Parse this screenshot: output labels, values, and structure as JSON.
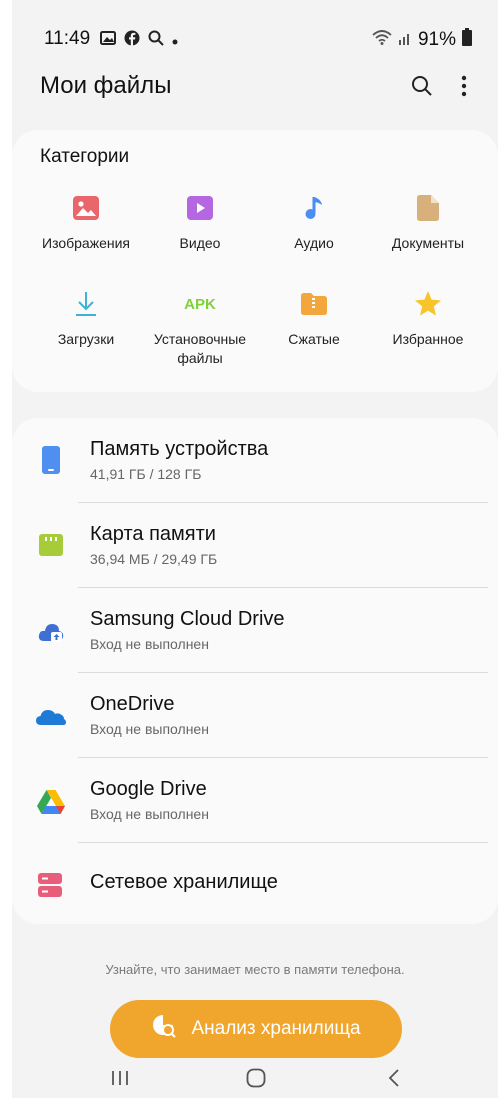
{
  "status_bar": {
    "time": "11:49",
    "battery": "91%"
  },
  "header": {
    "title": "Мои файлы"
  },
  "categories": {
    "title": "Категории",
    "items": [
      {
        "label": "Изображения",
        "icon": "image-icon",
        "color": "#e9676b"
      },
      {
        "label": "Видео",
        "icon": "video-icon",
        "color": "#b467e0"
      },
      {
        "label": "Аудио",
        "icon": "music-note-icon",
        "color": "#4a8ff0"
      },
      {
        "label": "Документы",
        "icon": "document-icon",
        "color": "#d7b07c"
      },
      {
        "label": "Загрузки",
        "icon": "download-icon",
        "color": "#3fb1d5"
      },
      {
        "label": "Установочные файлы",
        "icon_text": "APK",
        "icon": "apk-icon",
        "color": "#7fd13b"
      },
      {
        "label": "Сжатые",
        "icon": "archive-icon",
        "color": "#f3a63b"
      },
      {
        "label": "Избранное",
        "icon": "star-icon",
        "color": "#f7c52b"
      }
    ]
  },
  "storage": [
    {
      "name": "Память устройства",
      "sub": "41,91 ГБ / 128 ГБ",
      "icon": "phone-storage-icon",
      "color": "#4e8ff0"
    },
    {
      "name": "Карта памяти",
      "sub": "36,94 МБ / 29,49 ГБ",
      "icon": "sd-card-icon",
      "color": "#a6cc3a"
    },
    {
      "name": "Samsung Cloud Drive",
      "sub": "Вход не выполнен",
      "icon": "samsung-cloud-icon",
      "color": "#3f6fd4"
    },
    {
      "name": "OneDrive",
      "sub": "Вход не выполнен",
      "icon": "onedrive-icon",
      "color": "#1f7ad6"
    },
    {
      "name": "Google Drive",
      "sub": "Вход не выполнен",
      "icon": "google-drive-icon",
      "color": "#34a853"
    },
    {
      "name": "Сетевое хранилище",
      "sub": "",
      "icon": "network-storage-icon",
      "color": "#e85d7a"
    }
  ],
  "hint": "Узнайте, что занимает место в памяти телефона.",
  "analyze_button": "Анализ хранилища"
}
